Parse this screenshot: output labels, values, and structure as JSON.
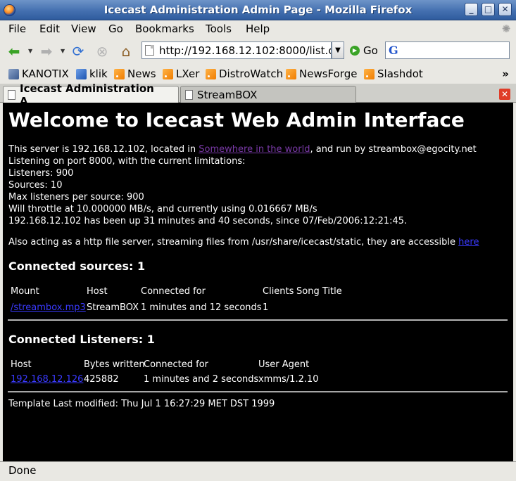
{
  "window": {
    "title": "Icecast Administration Admin Page - Mozilla Firefox"
  },
  "menu": [
    "File",
    "Edit",
    "View",
    "Go",
    "Bookmarks",
    "Tools",
    "Help"
  ],
  "toolbar": {
    "url": "http://192.168.12.102:8000/list.c",
    "go_label": "Go"
  },
  "bookmarks": [
    "KANOTIX",
    "klik",
    "News",
    "LXer",
    "DistroWatch",
    "NewsForge",
    "Slashdot"
  ],
  "bookmarks_more": "»",
  "tabs": [
    "Icecast Administration A...",
    "StreamBOX"
  ],
  "page": {
    "heading": "Welcome to Icecast Web Admin Interface",
    "server_prefix": "This server is 192.168.12.102, located in ",
    "location_link": "Somewhere in the world",
    "server_suffix": ", and run by streambox@egocity.net",
    "port_line": "Listening on port 8000, with the current limitations:",
    "listeners_line": "Listeners: 900",
    "sources_line": "Sources: 10",
    "max_listeners_line": "Max listeners per source: 900",
    "throttle_line": "Will throttle at 10.000000 MB/s, and currently using 0.016667 MB/s",
    "uptime_line": "192.168.12.102 has been up 31 minutes and 40 seconds, since 07/Feb/2006:12:21:45.",
    "fileserver_prefix": "Also acting as a http file server, streaming files from /usr/share/icecast/static, they are accessible ",
    "fileserver_link": "here",
    "sources_heading": "Connected sources: 1",
    "sources_table": {
      "headers": [
        "Mount",
        "Host",
        "Connected for",
        "Clients",
        "Song Title"
      ],
      "rows": [
        [
          "/streambox.mp3",
          "StreamBOX",
          "1 minutes and 12 seconds",
          "1",
          ""
        ]
      ]
    },
    "listeners_heading": "Connected Listeners: 1",
    "listeners_table": {
      "headers": [
        "Host",
        "Bytes written",
        "Connected for",
        "User Agent"
      ],
      "rows": [
        [
          "192.168.12.126",
          "425882",
          "1 minutes and 2 seconds",
          "xmms/1.2.10"
        ]
      ]
    },
    "template_line": "Template Last modified: Thu Jul 1 16:27:29 MET DST 1999"
  },
  "status": "Done"
}
